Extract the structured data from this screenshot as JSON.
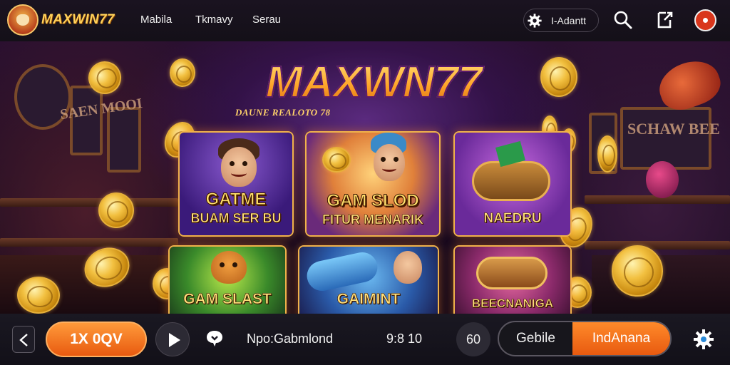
{
  "header": {
    "brand": "MAXWIN77",
    "nav": [
      "Mabila",
      "Tkmavy",
      "Serau"
    ],
    "admin_label": "I-Adantt",
    "icons": [
      "logo-badge",
      "gear-icon",
      "search-icon",
      "share-icon",
      "record-icon"
    ]
  },
  "hero": {
    "title": "MAXWN77",
    "subtitle": "DAUNE REALOTO 78",
    "games": [
      {
        "title": "GATME",
        "subtitle": "BUAM SER BU"
      },
      {
        "title": "GAM SLOD",
        "subtitle": "FITUR MENARIK"
      },
      {
        "title": "",
        "subtitle": "NAEDRU"
      },
      {
        "title": "",
        "subtitle": "GAM SLAST"
      },
      {
        "title": "",
        "subtitle": "GAIMINT"
      },
      {
        "title": "",
        "subtitle": "BEECNANIGA"
      }
    ]
  },
  "controls": {
    "back_icon": "chevron-left-icon",
    "primary_label": "1X 0QV",
    "play_icon": "play-icon",
    "chat_icon": "chat-icon",
    "info_text": "Npo:Gabmlond",
    "time_text": "9:8 10",
    "counter_text": "60",
    "toggle_options": [
      "Gebile",
      "IndAnana"
    ],
    "settings_icon": "settings-icon"
  },
  "colors": {
    "accent": "#f0731c",
    "brand": "#ffd25a",
    "background": "#120a1e"
  }
}
